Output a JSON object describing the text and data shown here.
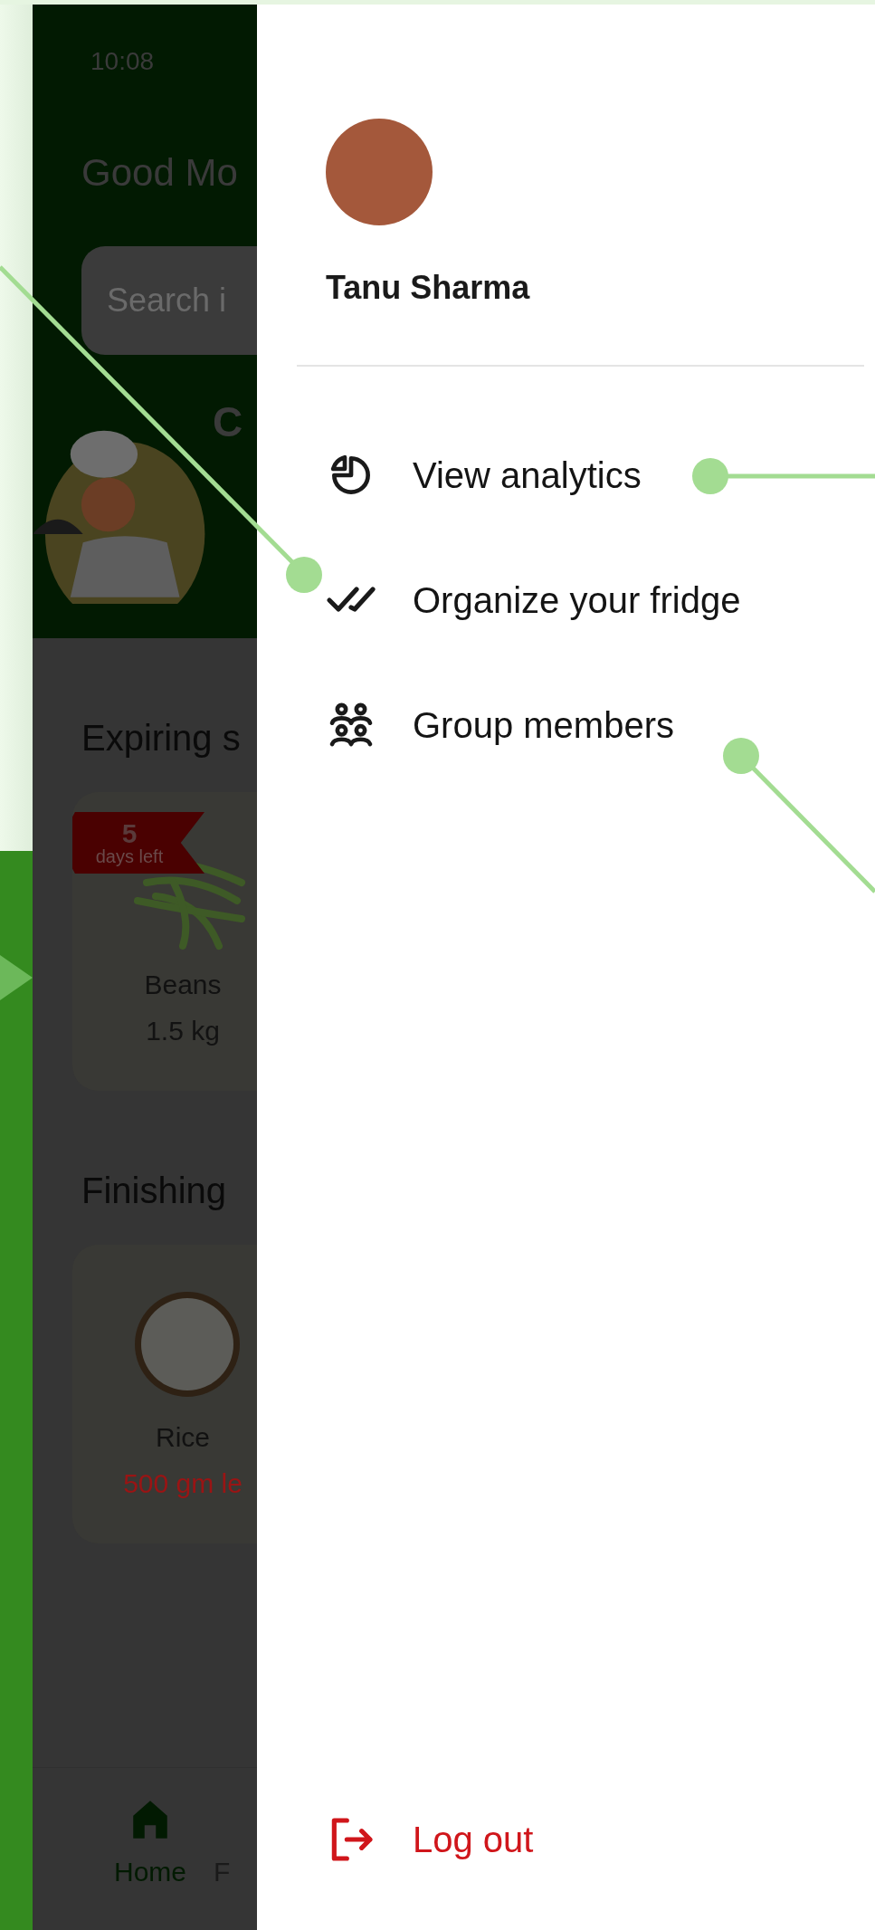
{
  "status_bar": {
    "time": "10:08"
  },
  "greeting": "Good Mo",
  "search": {
    "placeholder": "Search i"
  },
  "banner_heading": "C",
  "sections": [
    {
      "title": "Expiring s",
      "items": [
        {
          "kind": "expiring",
          "name": "Beans",
          "badge_number": "5",
          "badge_text": "days left",
          "quantity": "1.5 kg"
        }
      ]
    },
    {
      "title": "Finishing",
      "items": [
        {
          "kind": "finishing",
          "name": "Rice",
          "quantity": "500 gm le"
        }
      ]
    }
  ],
  "bottom_nav": [
    {
      "label": "Home",
      "selected": true
    },
    {
      "label": "F",
      "selected": false
    }
  ],
  "drawer": {
    "user_name": "Tanu Sharma",
    "menu": [
      {
        "kind": "analytics",
        "label": "View analytics"
      },
      {
        "kind": "organize",
        "label": "Organize your fridge"
      },
      {
        "kind": "group",
        "label": "Group members"
      }
    ],
    "logout": "Log out"
  }
}
